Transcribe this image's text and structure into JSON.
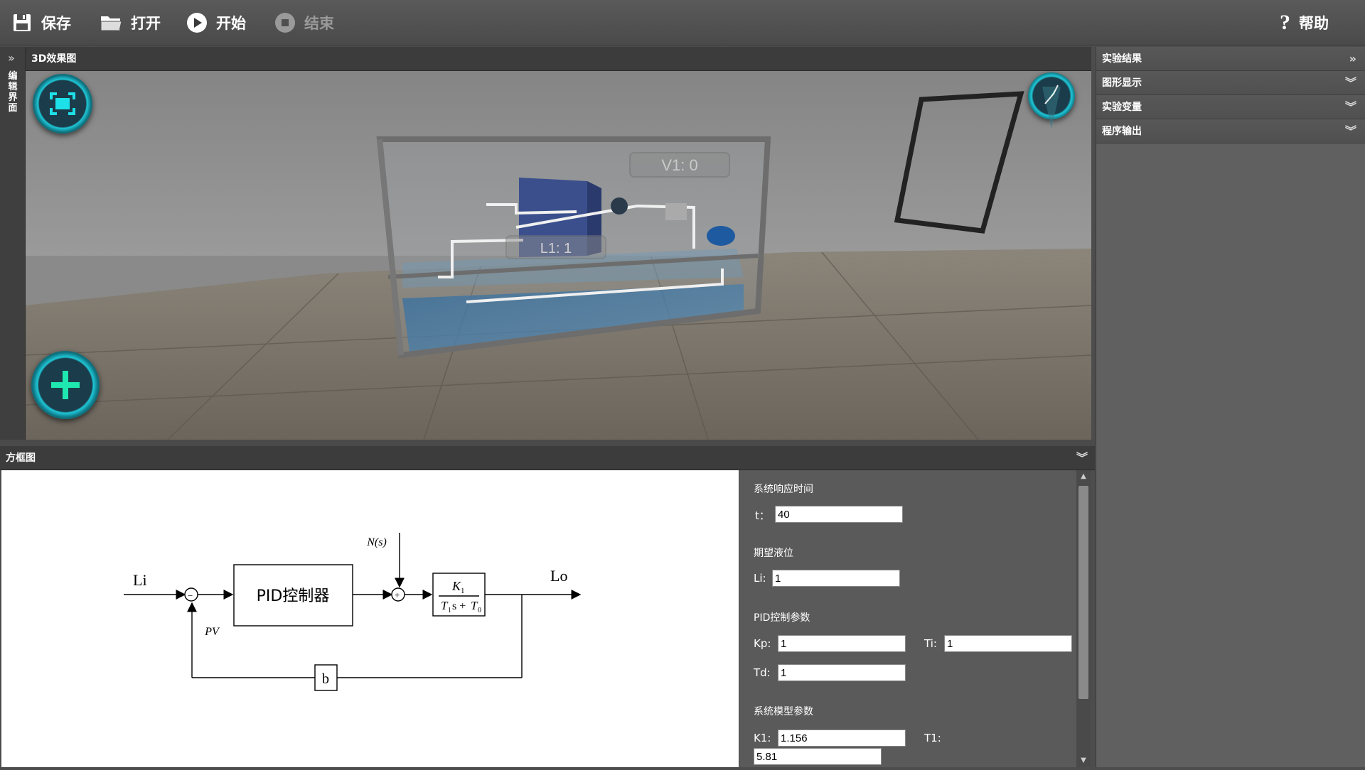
{
  "toolbar": {
    "save_label": "保存",
    "open_label": "打开",
    "start_label": "开始",
    "stop_label": "结束",
    "help_label": "帮助"
  },
  "left_strip": {
    "label": "编辑界面"
  },
  "view3d": {
    "title": "3D效果图",
    "tank_label_v1": "V1: 0",
    "tank_label_l1": "L1: 1"
  },
  "right_panel": {
    "items": [
      {
        "label": "实验结果"
      },
      {
        "label": "图形显示"
      },
      {
        "label": "实验变量"
      },
      {
        "label": "程序输出"
      }
    ]
  },
  "block_diagram": {
    "title": "方框图",
    "input_label": "Li",
    "output_label": "Lo",
    "controller_label": "PID控制器",
    "disturbance_label": "N(s)",
    "feedback_label": "PV",
    "feedback_block_label": "b",
    "tf_numerator": "K",
    "tf_num_sub": "1",
    "tf_den_T": "T",
    "tf_den_sub1": "1",
    "tf_den_s": "s +",
    "tf_den_T0": "T",
    "tf_den_sub0": "0",
    "plus_sign": "+",
    "minus_sign": "−"
  },
  "params": {
    "response_time_title": "系统响应时间",
    "t_label": "t：",
    "t_value": "40",
    "desired_level_title": "期望液位",
    "li_label": "Li:",
    "li_value": "1",
    "pid_title": "PID控制参数",
    "kp_label": "Kp:",
    "kp_value": "1",
    "ti_label": "Ti:",
    "ti_value": "1",
    "td_label": "Td:",
    "td_value": "1",
    "model_title": "系统模型参数",
    "k1_label": "K1:",
    "k1_value": "1.156",
    "t1_label": "T1:",
    "t1_value": "5.81"
  },
  "colors": {
    "accent": "#1ec8d8",
    "toolbar_bg": "#505050",
    "panel_bg": "#606060"
  }
}
